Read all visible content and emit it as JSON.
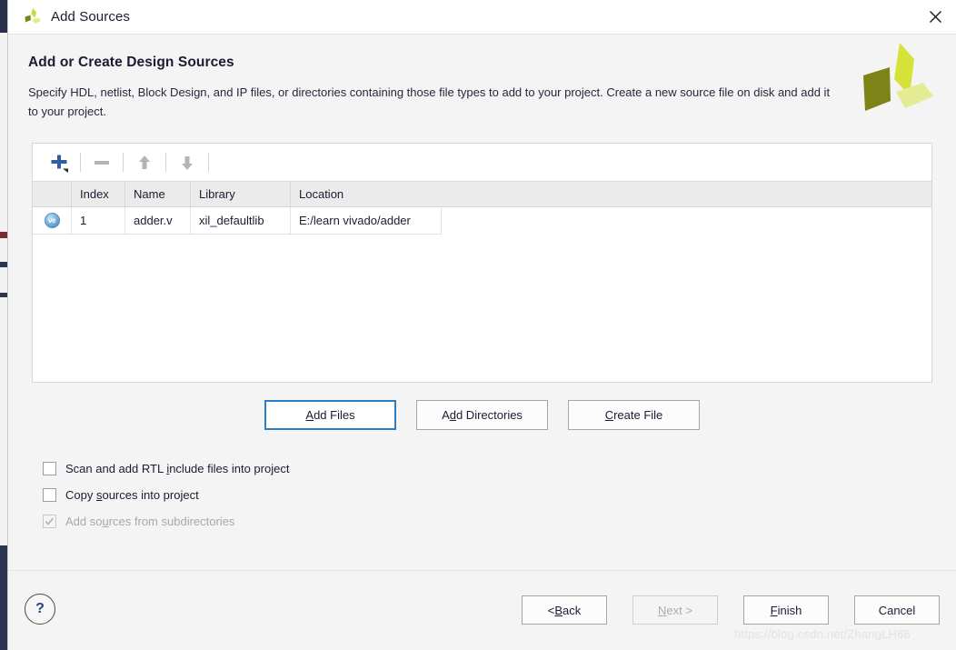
{
  "window": {
    "title": "Add Sources",
    "app_icon": "vivado-logo-icon",
    "close_icon": "close-icon"
  },
  "header": {
    "title": "Add or Create Design Sources",
    "description": "Specify HDL, netlist, Block Design, and IP files, or directories containing those file types to add to your project. Create a new source file on disk and add it to your project.",
    "brand_icon": "vivado-logo-icon"
  },
  "toolbar": {
    "buttons": [
      {
        "name": "add-button",
        "icon": "plus-icon",
        "enabled": true
      },
      {
        "name": "remove-button",
        "icon": "minus-icon",
        "enabled": false
      },
      {
        "name": "move-up-button",
        "icon": "arrow-up-icon",
        "enabled": false
      },
      {
        "name": "move-down-button",
        "icon": "arrow-down-icon",
        "enabled": false
      }
    ]
  },
  "table": {
    "columns": [
      "",
      "Index",
      "Name",
      "Library",
      "Location"
    ],
    "rows": [
      {
        "file_icon": "verilog-file-icon",
        "file_icon_label": "ve",
        "index": "1",
        "name": "adder.v",
        "library": "xil_defaultlib",
        "location": "E:/learn vivado/adder"
      }
    ]
  },
  "actions": {
    "add_files": {
      "label": "Add Files",
      "mnemonic": "A",
      "focused": true
    },
    "add_directories": {
      "label": "Add Directories",
      "mnemonic": "d"
    },
    "create_file": {
      "label": "Create File",
      "mnemonic": "C"
    }
  },
  "options": [
    {
      "name": "scan-rtl-include-checkbox",
      "label_before": "Scan and add RTL ",
      "mnemonic": "i",
      "label_after": "nclude files into project",
      "checked": false,
      "enabled": true
    },
    {
      "name": "copy-sources-checkbox",
      "label_before": "Copy ",
      "mnemonic": "s",
      "label_after": "ources into project",
      "checked": false,
      "enabled": true
    },
    {
      "name": "add-subdirectories-checkbox",
      "label_before": "Add so",
      "mnemonic": "u",
      "label_after": "rces from subdirectories",
      "checked": true,
      "enabled": false
    }
  ],
  "footer": {
    "help": {
      "name": "help-button",
      "glyph": "?"
    },
    "back": {
      "label_before": "< ",
      "mnemonic": "B",
      "label_after": "ack",
      "enabled": true
    },
    "next": {
      "label_before": "",
      "mnemonic": "N",
      "label_after": "ext >",
      "enabled": false
    },
    "finish": {
      "label_before": "",
      "mnemonic": "F",
      "label_after": "inish",
      "enabled": true
    },
    "cancel": {
      "label_before": "Cancel",
      "mnemonic": "",
      "label_after": "",
      "enabled": true
    }
  },
  "watermark": {
    "text": "https://blog.csdn.net/ZhangLH66"
  },
  "colors": {
    "accent_blue": "#2e7cc4",
    "brand_dark": "#7d8417",
    "brand_mid": "#c9d92e",
    "brand_light": "#e2eb8c",
    "dialog_bg": "#f4f4f4",
    "header_row": "#ebebeb"
  }
}
